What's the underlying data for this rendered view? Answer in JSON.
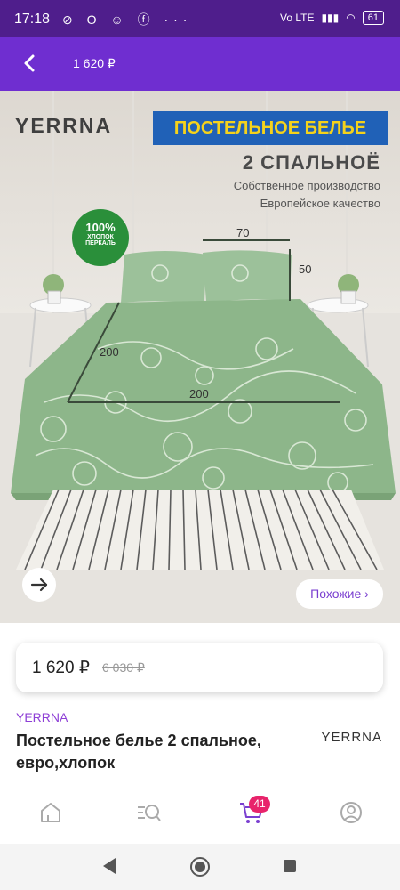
{
  "status_bar": {
    "time": "17:18",
    "icons": "⊘ O ☺ ⓕ ···",
    "network": "Vo LTE",
    "battery": "61"
  },
  "app_bar": {
    "title": "1 620 ₽"
  },
  "hero": {
    "brand": "YERRNA",
    "banner": "ПОСТЕЛЬНОЕ БЕЛЬЕ",
    "subtitle": "2 СПАЛЬНОЁ",
    "line1": "Собственное производство",
    "line2": "Европейское качество",
    "badge_top": "100%",
    "badge_line1": "ХЛОПОК",
    "badge_line2": "ПЕРКАЛЬ",
    "dim_pillow_w": "70",
    "dim_pillow_h": "50",
    "dim_length": "200",
    "dim_width": "200",
    "similar_label": "Похожие ›"
  },
  "price": {
    "current": "1 620 ₽",
    "old": "6 030 ₽"
  },
  "product": {
    "brand": "YERRNA",
    "title": "Постельное белье 2 спальное, евро,хлопок",
    "brand_logo": "YERRNA"
  },
  "nav": {
    "cart_count": "41"
  },
  "colors": {
    "status_bar": "#4f1e8c",
    "app_bar": "#6f2ed0",
    "accent": "#8e3fd6",
    "badge": "#e8236b"
  }
}
